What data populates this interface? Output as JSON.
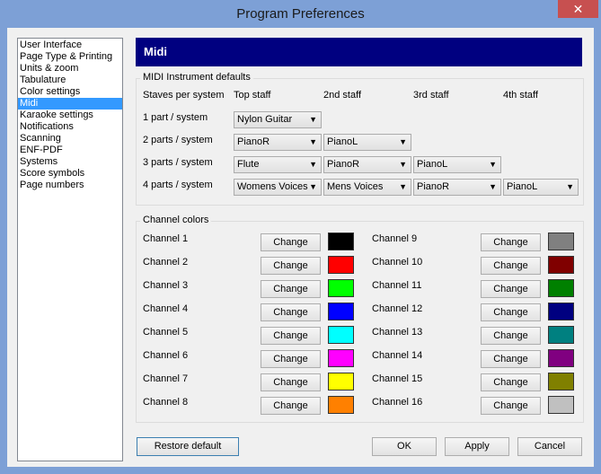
{
  "window": {
    "title": "Program Preferences",
    "close_glyph": "✕"
  },
  "nav": {
    "items": [
      "User Interface",
      "Page Type & Printing",
      "Units & zoom",
      "Tabulature",
      "Color settings",
      "Midi",
      "Karaoke settings",
      "Notifications",
      "Scanning",
      "ENF-PDF",
      "Systems",
      "Score symbols",
      "Page numbers"
    ],
    "selected": "Midi"
  },
  "heading": "Midi",
  "instruments": {
    "group_label": "MIDI Instrument defaults",
    "headers": [
      "Staves per system",
      "Top staff",
      "2nd staff",
      "3rd staff",
      "4th staff"
    ],
    "rows": [
      {
        "label": "1 part / system",
        "values": [
          "Nylon Guitar"
        ]
      },
      {
        "label": "2 parts / system",
        "values": [
          "PianoR",
          "PianoL"
        ]
      },
      {
        "label": "3 parts / system",
        "values": [
          "Flute",
          "PianoR",
          "PianoL"
        ]
      },
      {
        "label": "4 parts / system",
        "values": [
          "Womens Voices",
          "Mens Voices",
          "PianoR",
          "PianoL"
        ]
      }
    ]
  },
  "channels": {
    "group_label": "Channel colors",
    "change_label": "Change",
    "items": [
      {
        "label": "Channel  1",
        "color": "#000000"
      },
      {
        "label": "Channel  2",
        "color": "#ff0000"
      },
      {
        "label": "Channel  3",
        "color": "#00ff00"
      },
      {
        "label": "Channel  4",
        "color": "#0000ff"
      },
      {
        "label": "Channel  5",
        "color": "#00ffff"
      },
      {
        "label": "Channel  6",
        "color": "#ff00ff"
      },
      {
        "label": "Channel  7",
        "color": "#ffff00"
      },
      {
        "label": "Channel  8",
        "color": "#ff8000"
      },
      {
        "label": "Channel  9",
        "color": "#808080"
      },
      {
        "label": "Channel 10",
        "color": "#800000"
      },
      {
        "label": "Channel 11",
        "color": "#008000"
      },
      {
        "label": "Channel 12",
        "color": "#000080"
      },
      {
        "label": "Channel 13",
        "color": "#008080"
      },
      {
        "label": "Channel 14",
        "color": "#800080"
      },
      {
        "label": "Channel 15",
        "color": "#808000"
      },
      {
        "label": "Channel 16",
        "color": "#c0c0c0"
      }
    ]
  },
  "footer": {
    "restore": "Restore default",
    "ok": "OK",
    "apply": "Apply",
    "cancel": "Cancel"
  }
}
